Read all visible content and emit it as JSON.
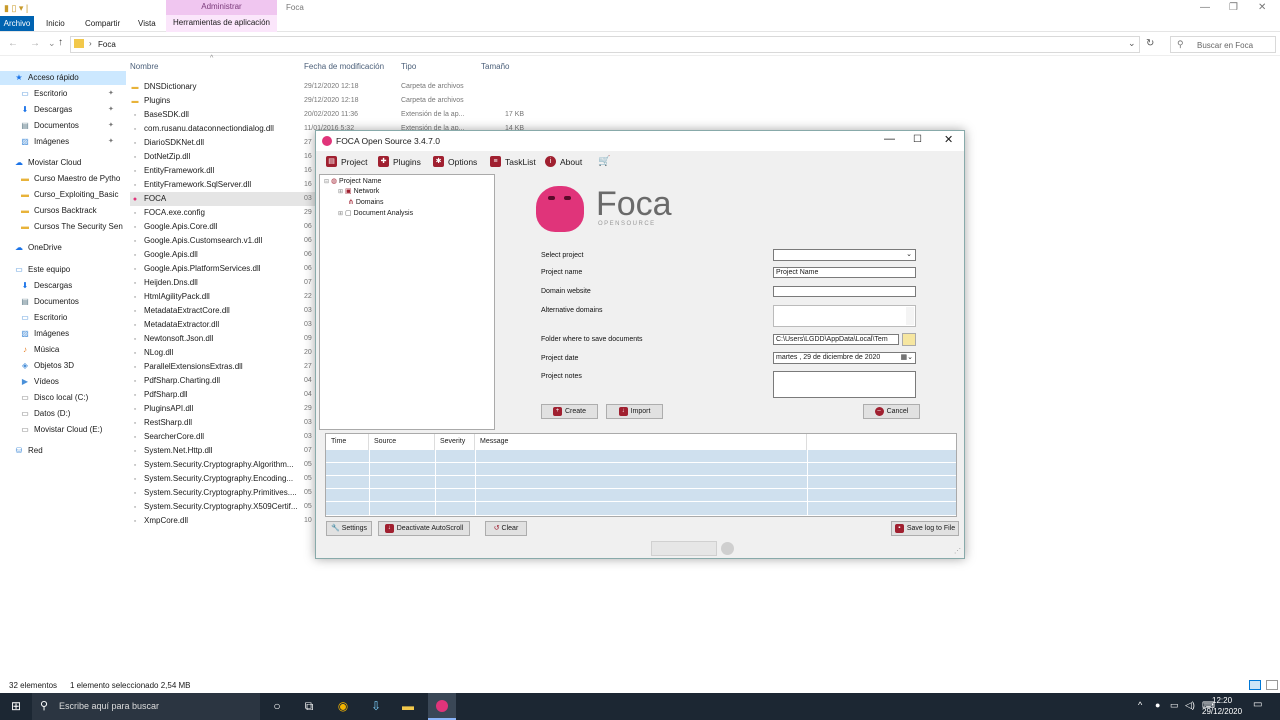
{
  "explorer": {
    "window_title": "Foca",
    "context_tab_header": "Administrar",
    "tabs": [
      "Archivo",
      "Inicio",
      "Compartir",
      "Vista",
      "Herramientas de aplicación"
    ],
    "address": "Foca",
    "search_placeholder": "Buscar en Foca",
    "columns": [
      "Nombre",
      "Fecha de modificación",
      "Tipo",
      "Tamaño"
    ],
    "sidebar": [
      {
        "label": "Acceso rápido",
        "icon": "star-icon",
        "indent": 0,
        "selected": true
      },
      {
        "label": "Escritorio",
        "icon": "desktop-icon",
        "indent": 1,
        "pin": true
      },
      {
        "label": "Descargas",
        "icon": "download-icon",
        "indent": 1,
        "pin": true
      },
      {
        "label": "Documentos",
        "icon": "document-icon",
        "indent": 1,
        "pin": true
      },
      {
        "label": "Imágenes",
        "icon": "image-icon",
        "indent": 1,
        "pin": true
      },
      {
        "label": "Movistar Cloud",
        "icon": "cloud-icon",
        "indent": 0
      },
      {
        "label": "Curso Maestro de Pytho",
        "icon": "folder-icon",
        "indent": 1
      },
      {
        "label": "Curso_Exploiting_Basic",
        "icon": "folder-icon",
        "indent": 1
      },
      {
        "label": "Cursos Backtrack",
        "icon": "folder-icon",
        "indent": 1
      },
      {
        "label": "Cursos The Security Sen",
        "icon": "folder-icon",
        "indent": 1
      },
      {
        "label": "OneDrive",
        "icon": "cloud-icon",
        "indent": 0
      },
      {
        "label": "Este equipo",
        "icon": "computer-icon",
        "indent": 0
      },
      {
        "label": "Descargas",
        "icon": "download-icon",
        "indent": 1
      },
      {
        "label": "Documentos",
        "icon": "document-icon",
        "indent": 1
      },
      {
        "label": "Escritorio",
        "icon": "desktop-icon",
        "indent": 1
      },
      {
        "label": "Imágenes",
        "icon": "image-icon",
        "indent": 1
      },
      {
        "label": "Música",
        "icon": "music-icon",
        "indent": 1
      },
      {
        "label": "Objetos 3D",
        "icon": "cube-icon",
        "indent": 1
      },
      {
        "label": "Vídeos",
        "icon": "video-icon",
        "indent": 1
      },
      {
        "label": "Disco local (C:)",
        "icon": "drive-icon",
        "indent": 1
      },
      {
        "label": "Datos (D:)",
        "icon": "drive-icon",
        "indent": 1
      },
      {
        "label": "Movistar Cloud (E:)",
        "icon": "drive-icon",
        "indent": 1
      },
      {
        "label": "Red",
        "icon": "network-icon",
        "indent": 0
      }
    ],
    "files": [
      {
        "name": "DNSDictionary",
        "icon": "folder-icon",
        "date": "29/12/2020 12:18",
        "type": "Carpeta de archivos",
        "size": ""
      },
      {
        "name": "Plugins",
        "icon": "folder-icon",
        "date": "29/12/2020 12:18",
        "type": "Carpeta de archivos",
        "size": ""
      },
      {
        "name": "BaseSDK.dll",
        "icon": "dll-icon",
        "date": "20/02/2020 11:36",
        "type": "Extensión de la ap...",
        "size": "17 KB"
      },
      {
        "name": "com.rusanu.dataconnectiondialog.dll",
        "icon": "dll-icon",
        "date": "11/01/2016 5:32",
        "type": "Extensión de la ap...",
        "size": "14 KB"
      },
      {
        "name": "DiarioSDKNet.dll",
        "icon": "dll-icon",
        "date": "27",
        "type": "",
        "size": ""
      },
      {
        "name": "DotNetZip.dll",
        "icon": "dll-icon",
        "date": "16",
        "type": "",
        "size": ""
      },
      {
        "name": "EntityFramework.dll",
        "icon": "dll-icon",
        "date": "16",
        "type": "",
        "size": ""
      },
      {
        "name": "EntityFramework.SqlServer.dll",
        "icon": "dll-icon",
        "date": "16",
        "type": "",
        "size": ""
      },
      {
        "name": "FOCA",
        "icon": "foca-icon",
        "date": "03",
        "type": "",
        "size": "",
        "selected": true
      },
      {
        "name": "FOCA.exe.config",
        "icon": "config-icon",
        "date": "29",
        "type": "",
        "size": ""
      },
      {
        "name": "Google.Apis.Core.dll",
        "icon": "dll-icon",
        "date": "06",
        "type": "",
        "size": ""
      },
      {
        "name": "Google.Apis.Customsearch.v1.dll",
        "icon": "dll-icon",
        "date": "06",
        "type": "",
        "size": ""
      },
      {
        "name": "Google.Apis.dll",
        "icon": "dll-icon",
        "date": "06",
        "type": "",
        "size": ""
      },
      {
        "name": "Google.Apis.PlatformServices.dll",
        "icon": "dll-icon",
        "date": "06",
        "type": "",
        "size": ""
      },
      {
        "name": "Heijden.Dns.dll",
        "icon": "dll-icon",
        "date": "07",
        "type": "",
        "size": ""
      },
      {
        "name": "HtmlAgilityPack.dll",
        "icon": "dll-icon",
        "date": "22",
        "type": "",
        "size": ""
      },
      {
        "name": "MetadataExtractCore.dll",
        "icon": "dll-icon",
        "date": "03",
        "type": "",
        "size": ""
      },
      {
        "name": "MetadataExtractor.dll",
        "icon": "dll-icon",
        "date": "03",
        "type": "",
        "size": ""
      },
      {
        "name": "Newtonsoft.Json.dll",
        "icon": "dll-icon",
        "date": "09",
        "type": "",
        "size": ""
      },
      {
        "name": "NLog.dll",
        "icon": "dll-icon",
        "date": "20",
        "type": "",
        "size": ""
      },
      {
        "name": "ParallelExtensionsExtras.dll",
        "icon": "dll-icon",
        "date": "27",
        "type": "",
        "size": ""
      },
      {
        "name": "PdfSharp.Charting.dll",
        "icon": "dll-icon",
        "date": "04",
        "type": "",
        "size": ""
      },
      {
        "name": "PdfSharp.dll",
        "icon": "dll-icon",
        "date": "04",
        "type": "",
        "size": ""
      },
      {
        "name": "PluginsAPI.dll",
        "icon": "dll-icon",
        "date": "29",
        "type": "",
        "size": ""
      },
      {
        "name": "RestSharp.dll",
        "icon": "dll-icon",
        "date": "03",
        "type": "",
        "size": ""
      },
      {
        "name": "SearcherCore.dll",
        "icon": "dll-icon",
        "date": "03",
        "type": "",
        "size": ""
      },
      {
        "name": "System.Net.Http.dll",
        "icon": "dll-icon",
        "date": "07",
        "type": "",
        "size": ""
      },
      {
        "name": "System.Security.Cryptography.Algorithm...",
        "icon": "dll-icon",
        "date": "05",
        "type": "",
        "size": ""
      },
      {
        "name": "System.Security.Cryptography.Encoding...",
        "icon": "dll-icon",
        "date": "05",
        "type": "",
        "size": ""
      },
      {
        "name": "System.Security.Cryptography.Primitives....",
        "icon": "dll-icon",
        "date": "05",
        "type": "",
        "size": ""
      },
      {
        "name": "System.Security.Cryptography.X509Certif...",
        "icon": "dll-icon",
        "date": "05",
        "type": "",
        "size": ""
      },
      {
        "name": "XmpCore.dll",
        "icon": "dll-icon",
        "date": "10",
        "type": "",
        "size": ""
      }
    ],
    "status_count": "32 elementos",
    "status_selection": "1 elemento seleccionado  2,54 MB"
  },
  "foca": {
    "title": "FOCA Open Source 3.4.7.0",
    "menu": [
      {
        "label": "Project",
        "icon": "project-icon"
      },
      {
        "label": "Plugins",
        "icon": "plugins-icon"
      },
      {
        "label": "Options",
        "icon": "options-icon"
      },
      {
        "label": "TaskList",
        "icon": "tasklist-icon"
      },
      {
        "label": "About",
        "icon": "about-icon"
      }
    ],
    "cart_icon": "cart-icon",
    "tree": {
      "root": "Project Name",
      "children": [
        "Network",
        "Domains",
        "Document Analysis"
      ]
    },
    "logo_text": "Foca",
    "logo_sub": "OPENSOURCE",
    "form": {
      "select_project_label": "Select project",
      "select_project_value": "",
      "project_name_label": "Project name",
      "project_name_value": "Project Name",
      "domain_label": "Domain website",
      "domain_value": "",
      "alt_domains_label": "Alternative domains",
      "alt_domains_value": "",
      "folder_label": "Folder where to save documents",
      "folder_value": "C:\\Users\\LGDD\\AppData\\Local\\Tem",
      "date_label": "Project date",
      "date_value": "martes  , 29 de  diciembre  de 2020",
      "notes_label": "Project notes",
      "notes_value": ""
    },
    "buttons": {
      "create": "Create",
      "import": "Import",
      "cancel": "Cancel",
      "settings": "Settings",
      "deactivate": "Deactivate AutoScroll",
      "clear": "Clear",
      "save_log": "Save log to File"
    },
    "log_columns": [
      "Time",
      "Source",
      "Severity",
      "Message"
    ]
  },
  "taskbar": {
    "search_placeholder": "Escribe aquí para buscar",
    "time": "12:20",
    "date": "29/12/2020"
  },
  "colors": {
    "accent": "#0063b1",
    "foca_pink": "#e0347a",
    "taskbar": "#1c2733",
    "log_row": "#cfe0ee"
  }
}
